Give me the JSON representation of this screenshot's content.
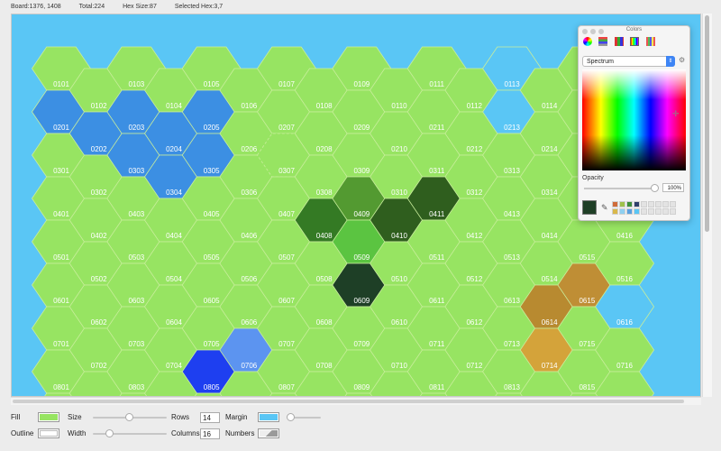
{
  "info": {
    "board": "Board:1376, 1408",
    "total": "Total:224",
    "hex_size": "Hex Size:87",
    "selected": "Selected Hex:3,7"
  },
  "board": {
    "cols": 16,
    "rows": 14,
    "margin_color": "#5ac6f5",
    "default_fill": "#97e462",
    "label_color": "#ffffff",
    "selected_hex": "0307",
    "special_fills": {
      "0201": "#3c8fe3",
      "0202": "#3c8fe3",
      "0203": "#3c8fe3",
      "0204": "#3c8fe3",
      "0205": "#3c8fe3",
      "0303": "#3c8fe3",
      "0304": "#3c8fe3",
      "0305": "#3c8fe3",
      "0113": "#5ac6f5",
      "0213": "#5ac6f5",
      "0616": "#5ac6f5",
      "0409": "#539a31",
      "0408": "#347a24",
      "0410": "#2f5e1e",
      "0411": "#2f5e1e",
      "0509": "#5bc441",
      "0609": "#1e3f26",
      "0614": "#b88a30",
      "0615": "#bf8e35",
      "0714": "#d4a33a",
      "0706": "#5c94f0",
      "0805": "#1e3ff0",
      "0307": "#97e462"
    }
  },
  "controls": {
    "fill_label": "Fill",
    "fill_color": "#97e462",
    "size_label": "Size",
    "rows_label": "Rows",
    "rows_value": "14",
    "margin_label": "Margin",
    "margin_color": "#5ac6f5",
    "outline_label": "Outline",
    "outline_color": "#ffffff",
    "width_label": "Width",
    "columns_label": "Columns",
    "columns_value": "16",
    "numbers_label": "Numbers"
  },
  "colors_panel": {
    "title": "Colors",
    "mode": "Spectrum",
    "opacity_label": "Opacity",
    "opacity_value": "100%",
    "current_color": "#1f3f26",
    "palette": [
      "#cf6b3a",
      "#9fc14a",
      "#3e8f3a",
      "#2f3f6a",
      "#e3e3e3",
      "#e3e3e3",
      "#e3e3e3",
      "#e3e3e3",
      "#e3e3e3",
      "#d9b84a",
      "#8fd0f0",
      "#5aa0e0",
      "#5ac6f5",
      "#e3e3e3",
      "#e3e3e3",
      "#e3e3e3",
      "#e3e3e3",
      "#e3e3e3"
    ]
  }
}
